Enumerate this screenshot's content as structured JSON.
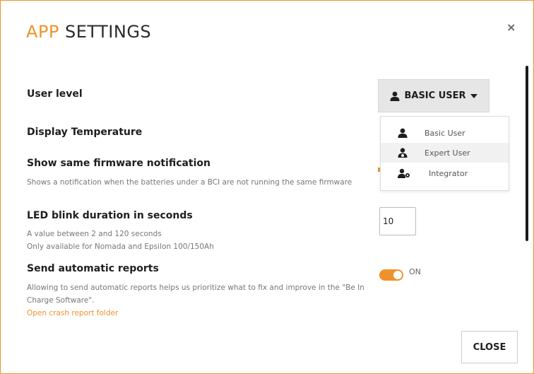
{
  "modal": {
    "title_accent": "APP",
    "title_rest": " SETTINGS",
    "close_x": "×",
    "close_button": "CLOSE"
  },
  "settings": {
    "user_level": {
      "title": "User level"
    },
    "display_temperature": {
      "title": "Display Temperature"
    },
    "firmware_notification": {
      "title": "Show same firmware notification",
      "description": "Shows a notification when the batteries under a BCI are not running the same firmware"
    },
    "led_blink": {
      "title": "LED blink duration in seconds",
      "description_line1": "A value between 2 and 120 seconds",
      "description_line2": "Only available for Nomada and Epsilon 100/150Ah",
      "value": "10"
    },
    "automatic_reports": {
      "title": "Send automatic reports",
      "description": "Allowing to send automatic reports helps us prioritize what to fix and improve in the \"Be In Charge Software\".",
      "link": "Open crash report folder",
      "toggle_state": "ON"
    }
  },
  "user_dropdown": {
    "selected": "BASIC USER",
    "options": [
      {
        "label": "Basic User",
        "icon": "user-icon"
      },
      {
        "label": "Expert User",
        "icon": "user-expert-icon"
      },
      {
        "label": "Integrator",
        "icon": "user-gear-icon"
      }
    ]
  },
  "colors": {
    "accent": "#f0922b",
    "button_bg": "#e6e6e6"
  }
}
